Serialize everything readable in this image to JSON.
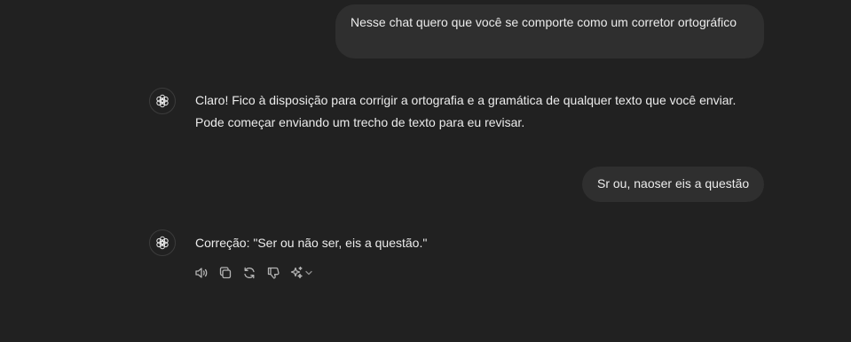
{
  "messages": [
    {
      "role": "user",
      "text": "Nesse chat quero que você se comporte como um corretor ortográfico"
    },
    {
      "role": "assistant",
      "lines": [
        "Claro! Fico à disposição para corrigir a ortografia e a gramática de qualquer texto que você enviar.",
        "Pode começar enviando um trecho de texto para eu revisar."
      ]
    },
    {
      "role": "user",
      "text": "Sr ou, naoser eis a questão"
    },
    {
      "role": "assistant",
      "lines": [
        "Correção: \"Ser ou não ser, eis a questão.\""
      ]
    }
  ],
  "actions": [
    {
      "icon": "speaker-icon"
    },
    {
      "icon": "copy-icon"
    },
    {
      "icon": "regenerate-icon"
    },
    {
      "icon": "thumbs-down-icon"
    },
    {
      "icon": "sparkle-icon"
    },
    {
      "icon": "chevron-down-icon"
    }
  ],
  "colors": {
    "background": "#212121",
    "user_bubble": "#2f2f2f",
    "text": "#ececec",
    "icon": "#b4b4b4"
  }
}
